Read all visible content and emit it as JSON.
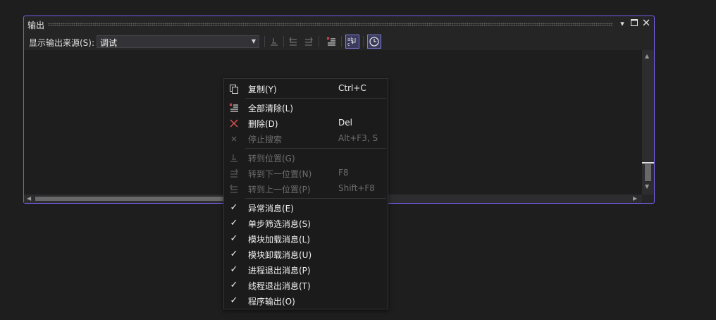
{
  "panel": {
    "title": "输出",
    "buttons": [
      "dropdown-icon",
      "maximize-icon",
      "close-icon"
    ],
    "source_label": "显示输出来源(S):",
    "source_value": "调试",
    "accent": "#7160e8"
  },
  "menu": {
    "items": [
      {
        "label": "复制(Y)",
        "shortcut": "Ctrl+C",
        "icon": "copy-icon",
        "enabled": true
      },
      {
        "label": "全部清除(L)",
        "shortcut": "",
        "icon": "clear-all-icon",
        "enabled": true
      },
      {
        "label": "删除(D)",
        "shortcut": "Del",
        "icon": "delete-icon",
        "enabled": true
      },
      {
        "label": "停止搜索",
        "shortcut": "Alt+F3, S",
        "icon": "stop-search-icon",
        "enabled": false
      },
      {
        "label": "转到位置(G)",
        "shortcut": "",
        "icon": "goto-location-icon",
        "enabled": false
      },
      {
        "label": "转到下一位置(N)",
        "shortcut": "F8",
        "icon": "goto-next-icon",
        "enabled": false
      },
      {
        "label": "转到上一位置(P)",
        "shortcut": "Shift+F8",
        "icon": "goto-prev-icon",
        "enabled": false
      },
      {
        "label": "异常消息(E)",
        "checked": true
      },
      {
        "label": "单步筛选消息(S)",
        "checked": true
      },
      {
        "label": "模块加载消息(L)",
        "checked": true
      },
      {
        "label": "模块卸载消息(U)",
        "checked": true
      },
      {
        "label": "进程退出消息(P)",
        "checked": true
      },
      {
        "label": "线程退出消息(T)",
        "checked": true
      },
      {
        "label": "程序输出(O)",
        "checked": true
      }
    ]
  }
}
